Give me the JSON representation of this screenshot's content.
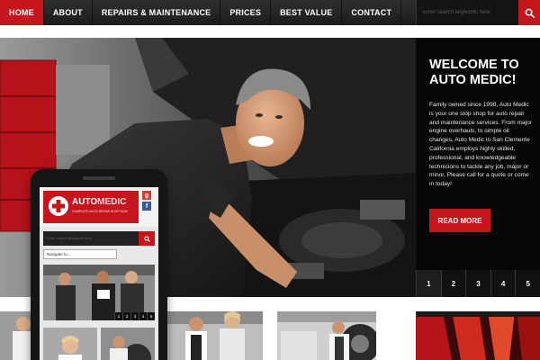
{
  "nav": {
    "items": [
      "HOME",
      "ABOUT",
      "REPAIRS & MAINTENANCE",
      "PRICES",
      "BEST VALUE",
      "CONTACT"
    ],
    "active_index": 0
  },
  "search": {
    "placeholder": "Enter search keywords here",
    "icon": "search-icon"
  },
  "hero": {
    "title": "WELCOME TO AUTO MEDIC!",
    "text": "Family owned since 1998, Auto Medic is your one stop shop for auto repair and maintenance services. From major engine overhauls, to simple oil changes, Auto Medic in San Clemente California employs highly skilled, professional, and knowledgeable technicions to tackle any job, major or minor. Please call for a quote or come in today!",
    "button": "READ MORE",
    "pages": [
      "1",
      "2",
      "3",
      "4",
      "5"
    ]
  },
  "mobile": {
    "logo_auto": "AUTO",
    "logo_medic": "MEDIC",
    "tagline": "Complete auto repair shop now",
    "search_placeholder": "Enter search keywords here",
    "navigate_label": "Navigate to...",
    "pages": [
      "1",
      "2",
      "3",
      "4",
      "5"
    ]
  },
  "colors": {
    "accent": "#c4161c",
    "nav_bg": "#262626",
    "panel_bg": "#0a0a0a"
  }
}
